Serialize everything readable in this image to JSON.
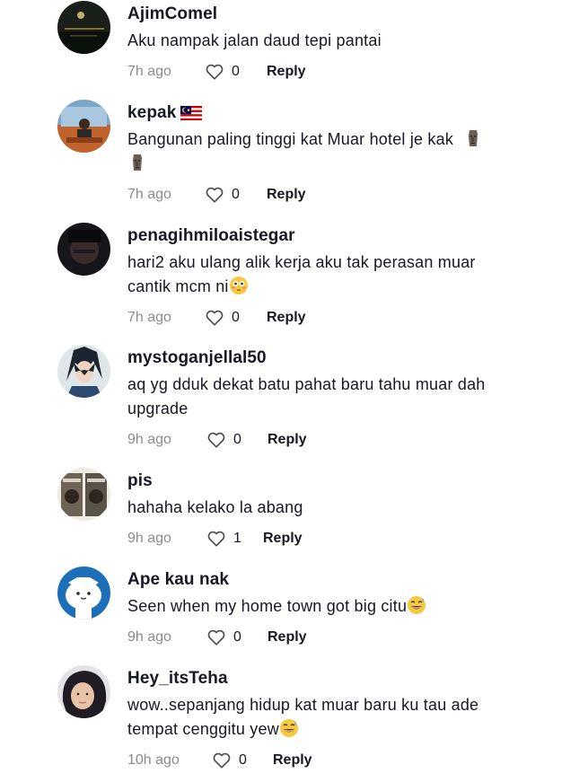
{
  "comments": [
    {
      "username": "AjimComel",
      "text": "Aku nampak jalan daud tepi pantai",
      "time": "7h ago",
      "likes": "0",
      "reply_label": "Reply"
    },
    {
      "username": "kepak",
      "flag": "malaysia-flag-emoji",
      "text": "Bangunan paling tinggi kat Muar hotel je kak",
      "emoji": "moai-emoji",
      "time": "7h ago",
      "likes": "0",
      "reply_label": "Reply"
    },
    {
      "username": "penagihmiloaistegar",
      "text": "hari2 aku ulang alik kerja aku tak perasan muar cantik mcm ni",
      "emoji": "flushed-face-emoji",
      "time": "7h ago",
      "likes": "0",
      "reply_label": "Reply"
    },
    {
      "username": "mystoganjellal50",
      "text": "aq yg dduk dekat batu pahat baru tahu muar dah upgrade",
      "time": "9h ago",
      "likes": "0",
      "reply_label": "Reply"
    },
    {
      "username": "pis",
      "text": "hahaha kelako la abang",
      "time": "9h ago",
      "likes": "1",
      "reply_label": "Reply"
    },
    {
      "username": "Ape kau nak",
      "text": "Seen when my home town got big citu",
      "emoji": "grinning-sweat-emoji",
      "time": "9h ago",
      "likes": "0",
      "reply_label": "Reply"
    },
    {
      "username": "Hey_itsTeha",
      "text": "wow..sepanjang hidup kat muar baru ku tau ade tempat cenggitu yew",
      "emoji": "grinning-sweat-emoji",
      "time": "10h ago",
      "likes": "0",
      "reply_label": "Reply"
    }
  ],
  "colors": {
    "text": "#161823",
    "secondary": "#8a8b91",
    "background": "#ffffff"
  }
}
